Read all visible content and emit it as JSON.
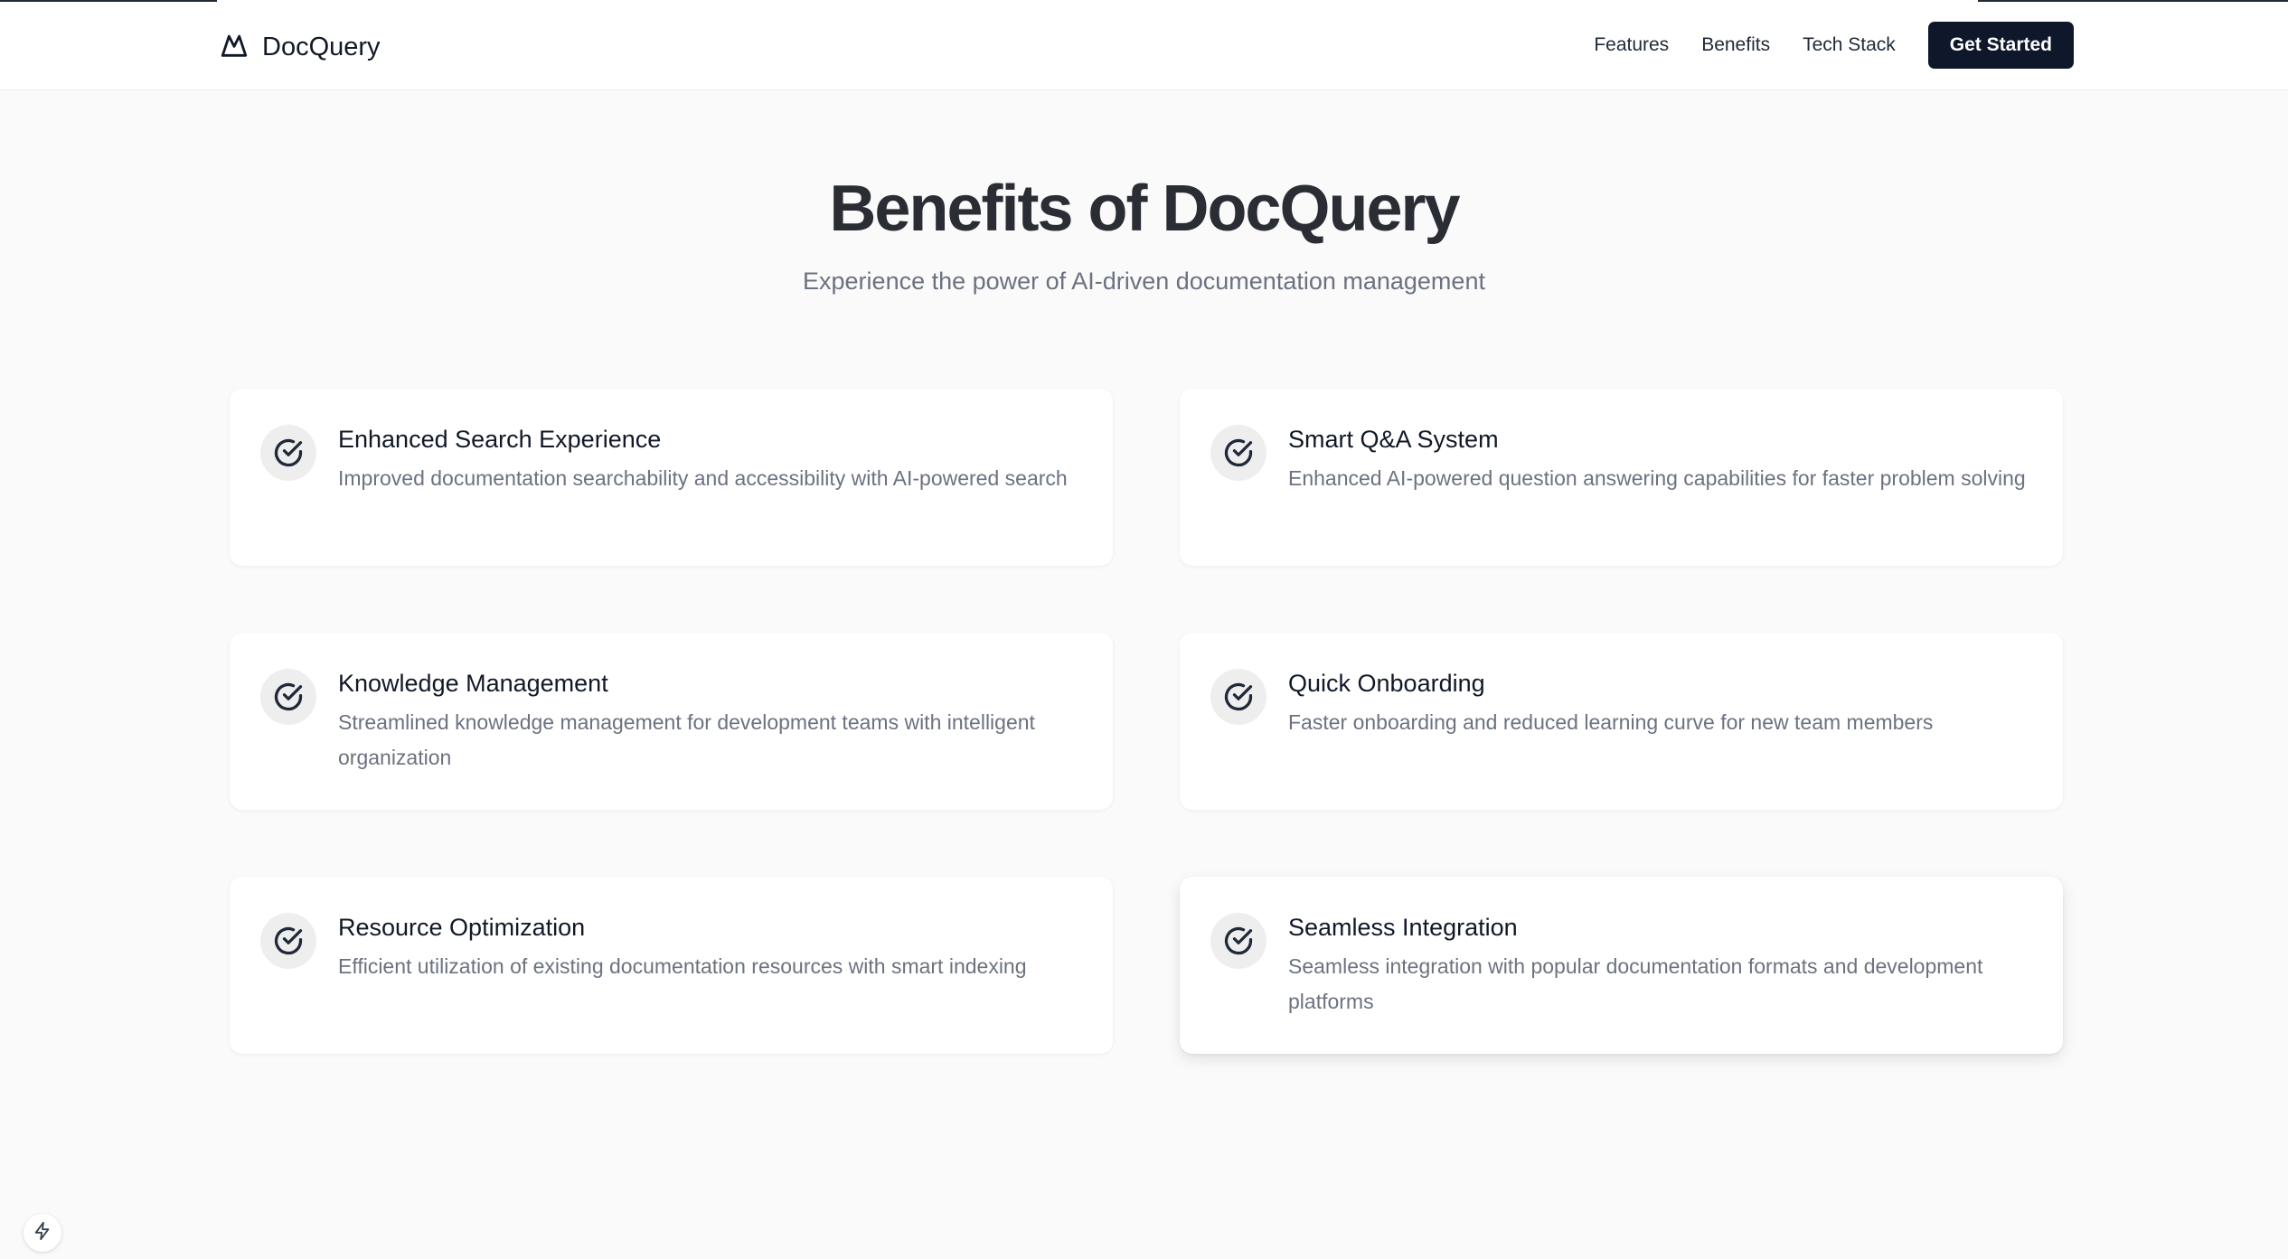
{
  "header": {
    "brand_name": "DocQuery",
    "brand_icon": "mountain-logo-icon",
    "nav": [
      {
        "label": "Features"
      },
      {
        "label": "Benefits"
      },
      {
        "label": "Tech Stack"
      }
    ],
    "cta_label": "Get Started"
  },
  "hero": {
    "title": "Benefits of DocQuery",
    "subtitle": "Experience the power of AI-driven documentation management"
  },
  "benefits": [
    {
      "title": "Enhanced Search Experience",
      "description": "Improved documentation searchability and accessibility with AI-powered search",
      "icon": "check-circle-icon"
    },
    {
      "title": "Smart Q&A System",
      "description": "Enhanced AI-powered question answering capabilities for faster problem solving",
      "icon": "check-circle-icon"
    },
    {
      "title": "Knowledge Management",
      "description": "Streamlined knowledge management for development teams with intelligent organization",
      "icon": "check-circle-icon"
    },
    {
      "title": "Quick Onboarding",
      "description": "Faster onboarding and reduced learning curve for new team members",
      "icon": "check-circle-icon"
    },
    {
      "title": "Resource Optimization",
      "description": "Efficient utilization of existing documentation resources with smart indexing",
      "icon": "check-circle-icon"
    },
    {
      "title": "Seamless Integration",
      "description": "Seamless integration with popular documentation formats and development platforms",
      "icon": "check-circle-icon"
    }
  ],
  "corner_badge_icon": "lightning-icon",
  "colors": {
    "primary_button": "#0f172a",
    "page_background": "#fafafa",
    "muted_text": "#6b7280"
  }
}
